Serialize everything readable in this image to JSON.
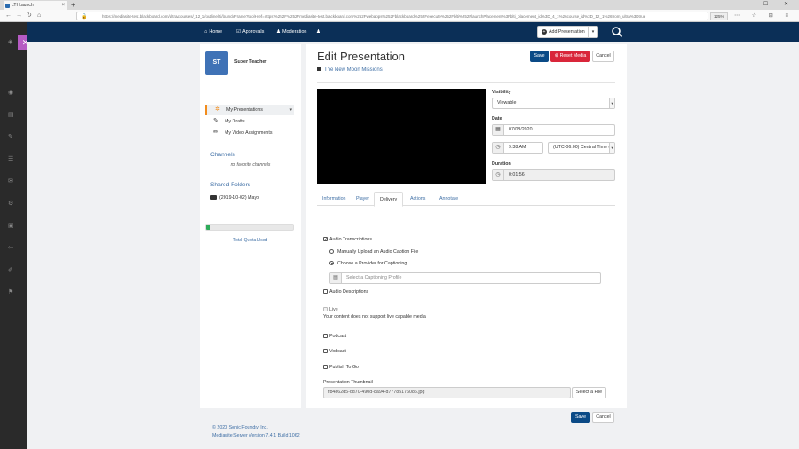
{
  "browser": {
    "tab_title": "LTI Launch",
    "url": "https://mediasite-test.blackboard.com/ultra/courses/_12_1/outline/lti/launchFrame?toolHref=https:%252F%252Fmediasite-test.blackboard.com%252Fwebapps%252Fblackboard%252Fexecute%252Fblti%252FlaunchPlacement%3Fblti_placement_id%3D_4_1%26course_id%3D_12_1%26from_ultra%3Dtrue",
    "zoom": "125%"
  },
  "nav": {
    "home": "Home",
    "approvals": "Approvals",
    "moderation": "Moderation",
    "add_presentation": "Add Presentation"
  },
  "sidebar": {
    "avatar_initials": "ST",
    "user_name": "Super Teacher",
    "items": [
      {
        "label": "My Presentations"
      },
      {
        "label": "My Drafts"
      },
      {
        "label": "My Video Assignments"
      }
    ],
    "channels_heading": "Channels",
    "channels_empty": "no favorite channels",
    "shared_heading": "Shared Folders",
    "shared_folder": "(2019-10-02) Mayo",
    "quota_fraction": 0.05,
    "quota_label": "Total Quota Used"
  },
  "editor": {
    "title": "Edit Presentation",
    "presentation_name": "The New Moon Missions",
    "save": "Save",
    "reset_media": "Reset Media",
    "cancel": "Cancel",
    "visibility_label": "Visibility",
    "visibility_value": "Viewable",
    "date_label": "Date",
    "date_value": "07/08/2020",
    "time_value": "9:38 AM",
    "timezone_value": "(UTC-06:00) Central Time (",
    "duration_label": "Duration",
    "duration_value": "0:01:56"
  },
  "tabs": [
    "Information",
    "Player",
    "Delivery",
    "Actions",
    "Annotate"
  ],
  "delivery": {
    "audio_transcriptions": "Audio Transcriptions",
    "manual_upload": "Manually Upload an Audio Caption File",
    "choose_provider": "Choose a Provider for Captioning",
    "caption_profile_placeholder": "Select a Captioning Profile",
    "audio_descriptions": "Audio Descriptions",
    "live": "Live",
    "live_note": "Your content does not support live capable media",
    "podcast": "Podcast",
    "vodcast": "Vodcast",
    "publish_to_go": "Publish To Go",
    "thumbnail_label": "Presentation Thumbnail",
    "thumbnail_file": "fb4862d5-dd70-490d-8a94-d77785176086.jpg",
    "select_file": "Select a File",
    "save": "Save",
    "cancel": "Cancel"
  },
  "footer": {
    "copyright": "© 2020 Sonic Foundry Inc.",
    "version": "Mediasite Server Version 7.4.1 Build 1062"
  },
  "colors": {
    "nav_bg": "#0b2f57",
    "primary": "#0b4a86",
    "danger": "#d9263a",
    "accent": "#f28c1c",
    "link": "#3f6fa5",
    "quota": "#2eac5a"
  }
}
